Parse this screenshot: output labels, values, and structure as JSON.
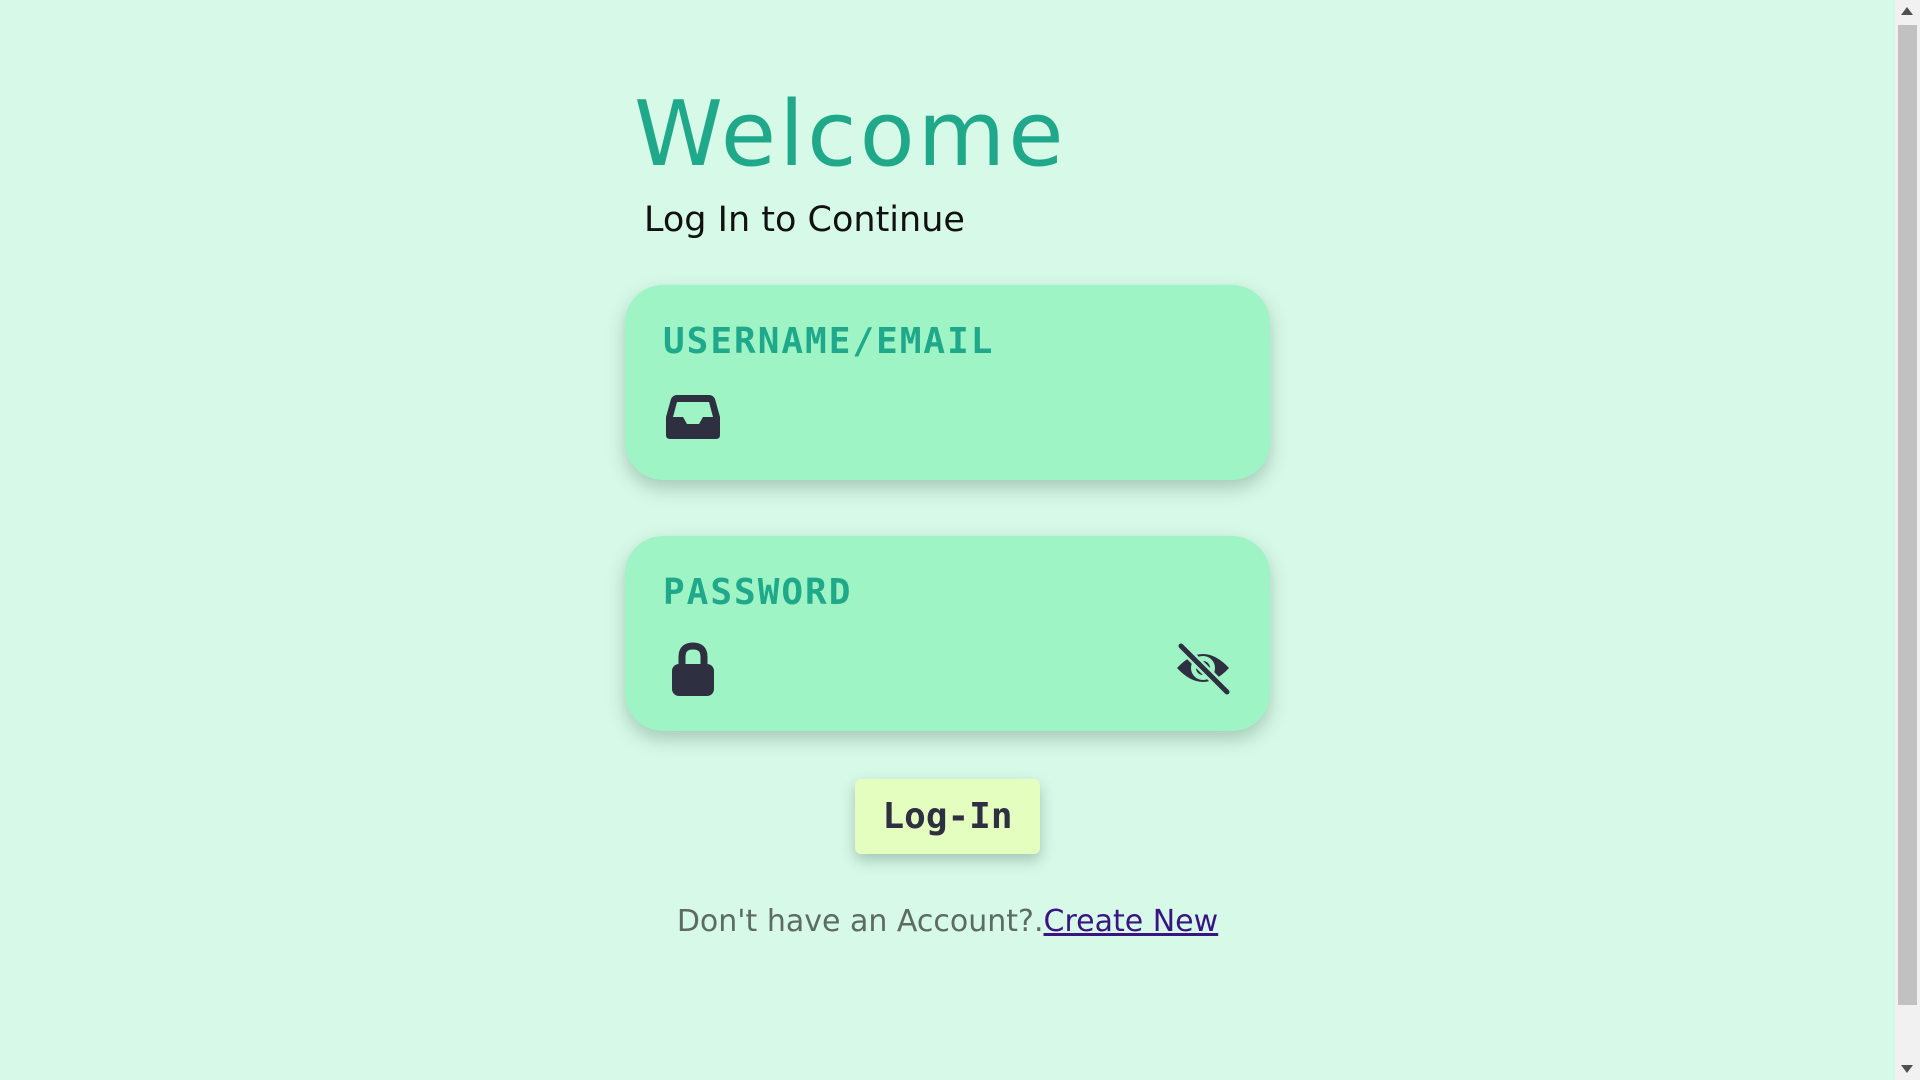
{
  "header": {
    "title": "Welcome",
    "subtitle": "Log In to Continue"
  },
  "username_field": {
    "label": "USERNAME/EMAIL",
    "value": "",
    "icon": "inbox-icon"
  },
  "password_field": {
    "label": "PASSWORD",
    "value": "",
    "icon": "lock-icon",
    "toggle_icon": "eye-slash-icon"
  },
  "login_button": {
    "label": "Log-In"
  },
  "footer": {
    "prompt": "Don't have an Account?.",
    "link_text": "Create New"
  },
  "colors": {
    "background": "#d7f9e8",
    "card": "#9ff4c6",
    "accent": "#1fa98a",
    "button": "#e4fec0",
    "icon": "#2f2f42",
    "link": "#3b1483"
  }
}
